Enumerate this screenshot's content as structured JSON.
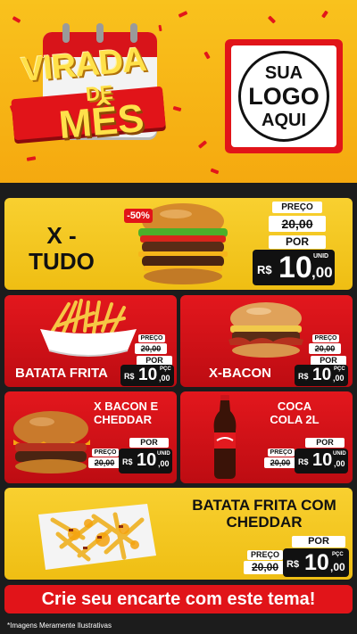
{
  "colors": {
    "accent_red": "#e11419",
    "accent_yellow": "#f8d030",
    "dark": "#111111"
  },
  "header": {
    "title_line1": "VIRADA",
    "title_line2": "DE",
    "title_line3": "MÊS",
    "logo_line1": "SUA",
    "logo_line2": "LOGO",
    "logo_line3": "AQUI"
  },
  "products": [
    {
      "name": "X - TUDO",
      "discount": "-50%",
      "preco_label": "PREÇO",
      "old_price": "20,00",
      "por_label": "POR",
      "currency": "R$",
      "price_int": "10",
      "price_dec": ",00",
      "unit": "UNID",
      "image": "burger-photo"
    },
    {
      "name": "BATATA FRITA",
      "preco_label": "PREÇO",
      "old_price": "20,00",
      "por_label": "POR",
      "currency": "R$",
      "price_int": "10",
      "price_dec": ",00",
      "unit": "PÇC",
      "image": "fries-photo"
    },
    {
      "name": "X-BACON",
      "preco_label": "PREÇO",
      "old_price": "20,00",
      "por_label": "POR",
      "currency": "R$",
      "price_int": "10",
      "price_dec": ",00",
      "unit": "PÇC",
      "image": "bacon-burger-photo"
    },
    {
      "name": "X BACON E CHEDDAR",
      "preco_label": "PREÇO",
      "old_price": "20,00",
      "por_label": "POR",
      "currency": "R$",
      "price_int": "10",
      "price_dec": ",00",
      "unit": "UNID",
      "image": "cheddar-burger-photo"
    },
    {
      "name": "COCA COLA 2L",
      "preco_label": "PREÇO",
      "old_price": "20,00",
      "por_label": "POR",
      "currency": "R$",
      "price_int": "10",
      "price_dec": ",00",
      "unit": "UNID",
      "image": "coca-cola-bottle-photo"
    },
    {
      "name": "BATATA FRITA COM CHEDDAR",
      "preco_label": "PREÇO",
      "old_price": "20,00",
      "por_label": "POR",
      "currency": "R$",
      "price_int": "10",
      "price_dec": ",00",
      "unit": "PÇC",
      "image": "cheddar-fries-photo"
    }
  ],
  "cta": {
    "label": "Crie seu encarte com este tema!"
  },
  "footer": {
    "note": "*Imagens Meramente Ilustrativas"
  }
}
